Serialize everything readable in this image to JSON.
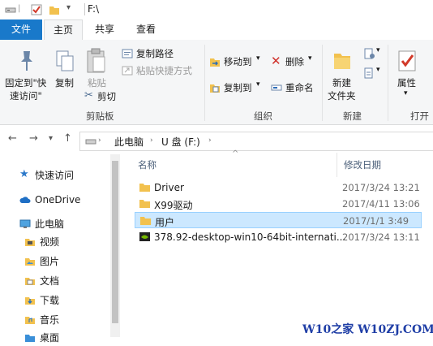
{
  "window": {
    "title": "F:\\"
  },
  "tabs": [
    {
      "label": "文件",
      "active": false
    },
    {
      "label": "主页",
      "active": true
    },
    {
      "label": "共享",
      "active": false
    },
    {
      "label": "查看",
      "active": false
    }
  ],
  "ribbon": {
    "clipboard": {
      "pin_label_1": "固定到\"快",
      "pin_label_2": "速访问\"",
      "copy": "复制",
      "paste": "粘贴",
      "copy_path": "复制路径",
      "paste_shortcut": "粘贴快捷方式",
      "cut": "剪切",
      "group": "剪贴板"
    },
    "organize": {
      "move_to": "移动到",
      "copy_to": "复制到",
      "delete": "删除",
      "rename": "重命名",
      "group": "组织"
    },
    "new": {
      "new_folder_1": "新建",
      "new_folder_2": "文件夹",
      "group": "新建"
    },
    "open": {
      "properties": "属性",
      "group": "打开"
    }
  },
  "address": {
    "crumbs": [
      "此电脑",
      "U 盘 (F:)"
    ]
  },
  "sidebar": {
    "items": [
      {
        "label": "快速访问",
        "icon": "star-icon"
      },
      {
        "label": "OneDrive",
        "icon": "cloud-icon"
      },
      {
        "label": "此电脑",
        "icon": "computer-icon"
      },
      {
        "label": "视频",
        "icon": "video-folder-icon"
      },
      {
        "label": "图片",
        "icon": "picture-folder-icon"
      },
      {
        "label": "文档",
        "icon": "document-folder-icon"
      },
      {
        "label": "下载",
        "icon": "download-folder-icon"
      },
      {
        "label": "音乐",
        "icon": "music-folder-icon"
      },
      {
        "label": "桌面",
        "icon": "desktop-folder-icon"
      }
    ]
  },
  "filelist": {
    "columns": {
      "name": "名称",
      "modified": "修改日期"
    },
    "rows": [
      {
        "name": "Driver",
        "date": "2017/3/24 13:21",
        "icon": "folder-icon",
        "selected": false
      },
      {
        "name": "X99驱动",
        "date": "2017/4/11 13:06",
        "icon": "folder-icon",
        "selected": false
      },
      {
        "name": "用户",
        "date": "2017/1/1 3:49",
        "icon": "folder-icon",
        "selected": true
      },
      {
        "name": "378.92-desktop-win10-64bit-internati...",
        "date": "2017/3/24 13:11",
        "icon": "nvidia-app-icon",
        "selected": false
      }
    ]
  },
  "watermark": "W10之家 W10ZJ.COM",
  "colors": {
    "accent": "#1979ca",
    "selection": "#cce8ff",
    "folder": "#f2c14e"
  }
}
